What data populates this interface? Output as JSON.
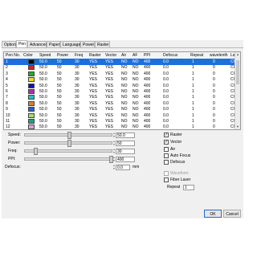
{
  "tabs": [
    "Options",
    "Pen",
    "Advanced",
    "Paper",
    "Language",
    "Power",
    "Raster"
  ],
  "active_tab": "Pen",
  "table": {
    "columns": [
      "Pen No.",
      "Color",
      "Speed",
      "Power",
      "Freq",
      "Raster",
      "Vector",
      "Air",
      "AF",
      "PPI",
      "Defocus",
      "Repeat",
      "wavelenth",
      "Laser"
    ],
    "rows": [
      {
        "no": "1",
        "color": "#000000",
        "speed": "50.0",
        "power": "50",
        "freq": "30",
        "raster": "YES",
        "vector": "YES",
        "air": "NO",
        "af": "NO",
        "ppi": "400",
        "defocus": "0.0",
        "repeat": "1",
        "wave": "0",
        "laser": "CO2"
      },
      {
        "no": "2",
        "color": "#e02020",
        "speed": "50.0",
        "power": "50",
        "freq": "30",
        "raster": "YES",
        "vector": "YES",
        "air": "NO",
        "af": "NO",
        "ppi": "400",
        "defocus": "0.0",
        "repeat": "1",
        "wave": "0",
        "laser": "CO2"
      },
      {
        "no": "3",
        "color": "#20b020",
        "speed": "50.0",
        "power": "50",
        "freq": "30",
        "raster": "YES",
        "vector": "YES",
        "air": "NO",
        "af": "NO",
        "ppi": "400",
        "defocus": "0.0",
        "repeat": "1",
        "wave": "0",
        "laser": "CO2"
      },
      {
        "no": "4",
        "color": "#f0e000",
        "speed": "50.0",
        "power": "50",
        "freq": "30",
        "raster": "YES",
        "vector": "YES",
        "air": "NO",
        "af": "NO",
        "ppi": "400",
        "defocus": "0.0",
        "repeat": "1",
        "wave": "0",
        "laser": "CO2"
      },
      {
        "no": "5",
        "color": "#1010c0",
        "speed": "50.0",
        "power": "50",
        "freq": "30",
        "raster": "YES",
        "vector": "YES",
        "air": "NO",
        "af": "NO",
        "ppi": "400",
        "defocus": "0.0",
        "repeat": "1",
        "wave": "0",
        "laser": "CO2"
      },
      {
        "no": "6",
        "color": "#c020c0",
        "speed": "50.0",
        "power": "50",
        "freq": "30",
        "raster": "YES",
        "vector": "YES",
        "air": "NO",
        "af": "NO",
        "ppi": "400",
        "defocus": "0.0",
        "repeat": "1",
        "wave": "0",
        "laser": "CO2"
      },
      {
        "no": "7",
        "color": "#20c0c0",
        "speed": "50.0",
        "power": "50",
        "freq": "30",
        "raster": "YES",
        "vector": "YES",
        "air": "NO",
        "af": "NO",
        "ppi": "400",
        "defocus": "0.0",
        "repeat": "1",
        "wave": "0",
        "laser": "CO2"
      },
      {
        "no": "8",
        "color": "#e08020",
        "speed": "50.0",
        "power": "50",
        "freq": "30",
        "raster": "YES",
        "vector": "YES",
        "air": "NO",
        "af": "NO",
        "ppi": "400",
        "defocus": "0.0",
        "repeat": "1",
        "wave": "0",
        "laser": "CO2"
      },
      {
        "no": "9",
        "color": "#2060e0",
        "speed": "50.0",
        "power": "50",
        "freq": "30",
        "raster": "YES",
        "vector": "YES",
        "air": "NO",
        "af": "NO",
        "ppi": "400",
        "defocus": "0.0",
        "repeat": "1",
        "wave": "0",
        "laser": "CO2"
      },
      {
        "no": "10",
        "color": "#a0e060",
        "speed": "50.0",
        "power": "50",
        "freq": "30",
        "raster": "YES",
        "vector": "YES",
        "air": "NO",
        "af": "NO",
        "ppi": "400",
        "defocus": "0.0",
        "repeat": "1",
        "wave": "0",
        "laser": "CO2"
      },
      {
        "no": "11",
        "color": "#20a080",
        "speed": "50.0",
        "power": "50",
        "freq": "30",
        "raster": "YES",
        "vector": "YES",
        "air": "NO",
        "af": "NO",
        "ppi": "400",
        "defocus": "0.0",
        "repeat": "1",
        "wave": "0",
        "laser": "CO2"
      },
      {
        "no": "12",
        "color": "#e0a0e0",
        "speed": "50.0",
        "power": "50",
        "freq": "30",
        "raster": "YES",
        "vector": "YES",
        "air": "NO",
        "af": "NO",
        "ppi": "400",
        "defocus": "0.0",
        "repeat": "1",
        "wave": "0",
        "laser": "CO2"
      }
    ],
    "selected_row": 0
  },
  "form": {
    "speed_label": "Speed:",
    "speed_value": "50.0",
    "speed_level": 0.5,
    "power_label": "Power:",
    "power_value": "50",
    "power_level": 0.5,
    "freq_label": "Freq:",
    "freq_value": "30",
    "freq_level": 0.1,
    "ppi_label": "PPI:",
    "ppi_value": "400",
    "ppi_level": 1.0,
    "defocus_label": "Defocus:",
    "defocus_value": "0.0",
    "defocus_unit": "mm"
  },
  "options": {
    "raster_label": "Raster",
    "raster_checked": true,
    "vector_label": "Vector",
    "vector_checked": true,
    "air_label": "Air",
    "air_checked": false,
    "autofocus_label": "Auto Focus",
    "autofocus_checked": false,
    "defocus_label": "Defocus",
    "defocus_checked": false,
    "waveform_label": "Waveform",
    "waveform_checked": false,
    "fiber_label": "Fiber Laser",
    "fiber_checked": false,
    "repeat_label": "Repeat",
    "repeat_value": "1"
  },
  "buttons": {
    "ok": "OK",
    "cancel": "Cancel"
  },
  "colors": {
    "accent": "#1e6fd9",
    "dialog_bg": "#f0f0f0"
  }
}
